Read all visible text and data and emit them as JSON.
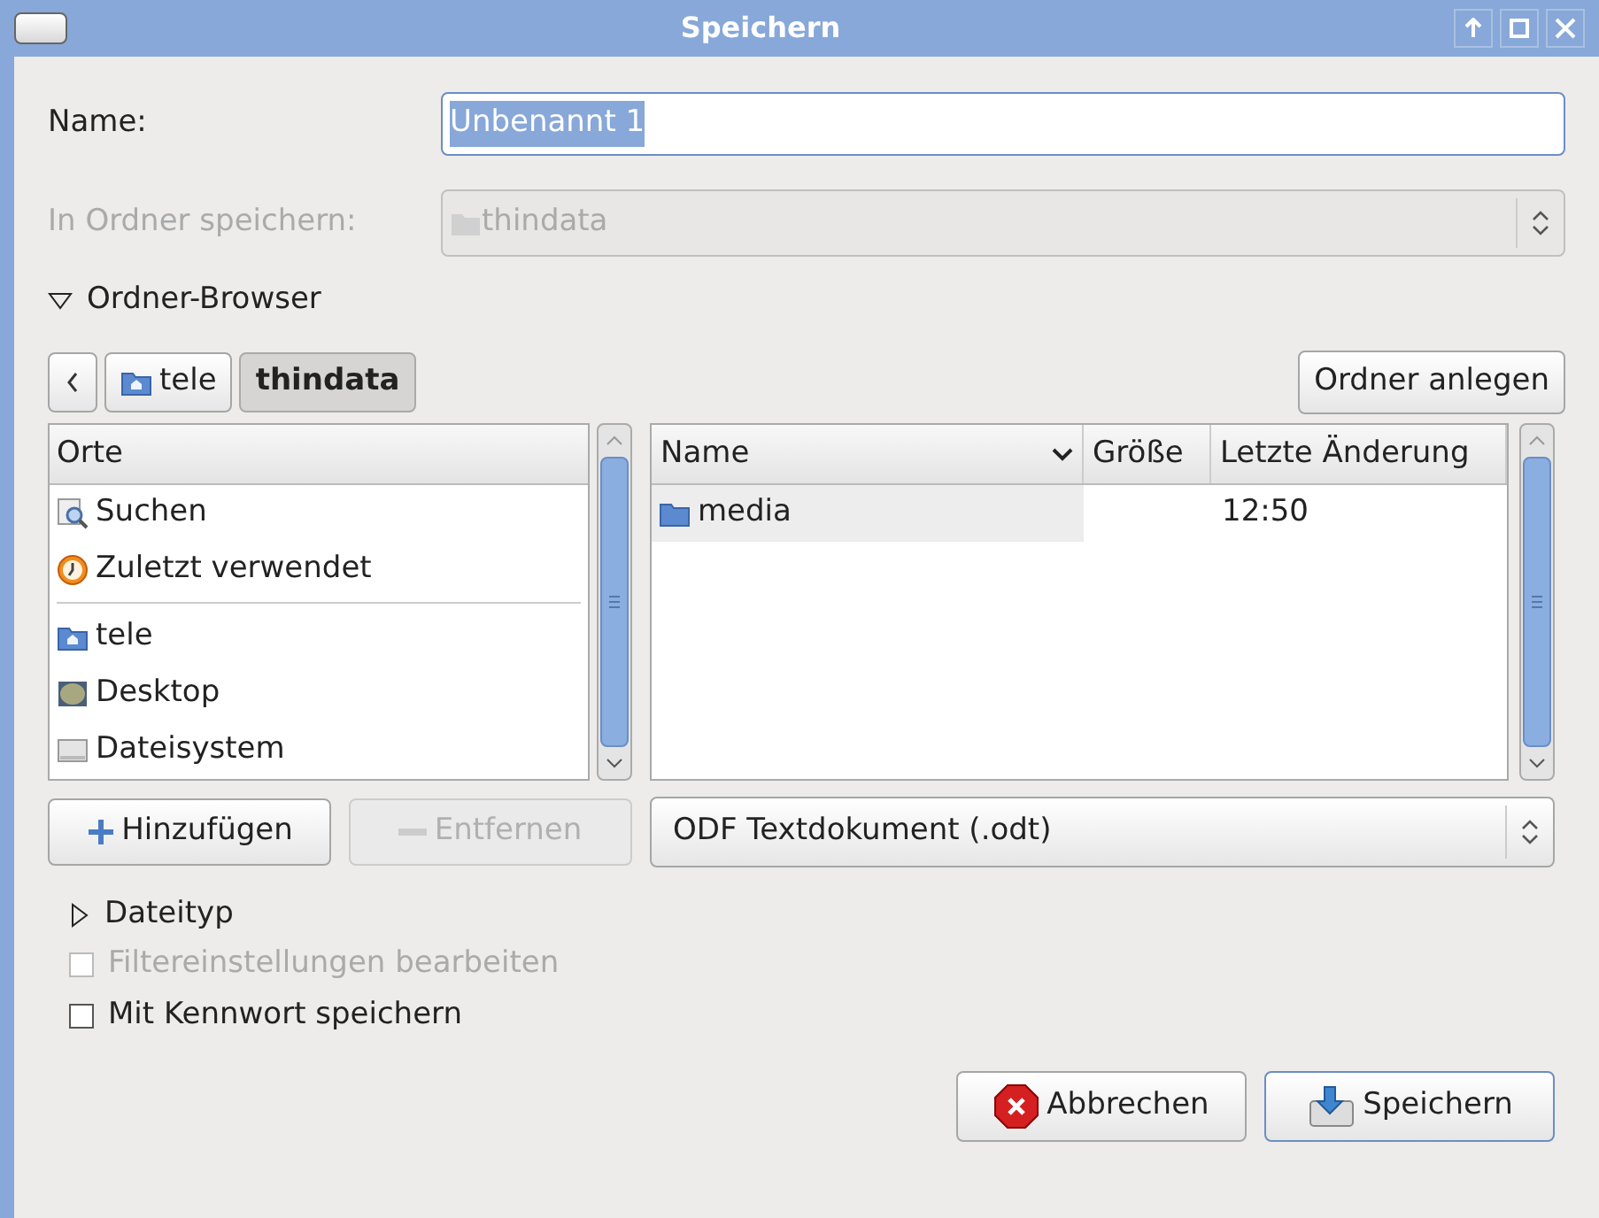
{
  "window": {
    "title": "Speichern"
  },
  "name_field": {
    "label": "Name:",
    "value": "Unbenannt 1",
    "text_selected": true
  },
  "folder_select": {
    "label": "In Ordner speichern:",
    "value": "thindata",
    "disabled": true
  },
  "browser_expander": {
    "label": "Ordner-Browser",
    "expanded": true
  },
  "path_bar": {
    "items": [
      {
        "label": "tele",
        "selected": false
      },
      {
        "label": "thindata",
        "selected": true
      }
    ]
  },
  "create_folder_button": {
    "label": "Ordner anlegen"
  },
  "places": {
    "header": "Orte",
    "items": [
      {
        "label": "Suchen",
        "kind": "search"
      },
      {
        "label": "Zuletzt verwendet",
        "kind": "recent"
      },
      {
        "label": "tele",
        "kind": "home"
      },
      {
        "label": "Desktop",
        "kind": "desktop"
      },
      {
        "label": "Dateisystem",
        "kind": "drive"
      }
    ]
  },
  "files": {
    "columns": [
      "Name",
      "Größe",
      "Letzte Änderung"
    ],
    "rows": [
      {
        "name": "media",
        "modified": "12:50",
        "selected": true
      }
    ]
  },
  "add_button": {
    "label": "Hinzufügen",
    "disabled": false
  },
  "remove_button": {
    "label": "Entfernen",
    "disabled": true
  },
  "filetype_select": {
    "value": "ODF Textdokument (.odt)"
  },
  "filetype_expander": {
    "label": "Dateityp",
    "expanded": false
  },
  "checkboxes": [
    {
      "label": "Filtereinstellungen bearbeiten",
      "checked": false,
      "disabled": true
    },
    {
      "label": "Mit Kennwort speichern",
      "checked": false,
      "disabled": false
    }
  ],
  "buttons": [
    {
      "label": "Abbrechen",
      "kind": "cancel"
    },
    {
      "label": "Speichern",
      "kind": "save"
    }
  ]
}
